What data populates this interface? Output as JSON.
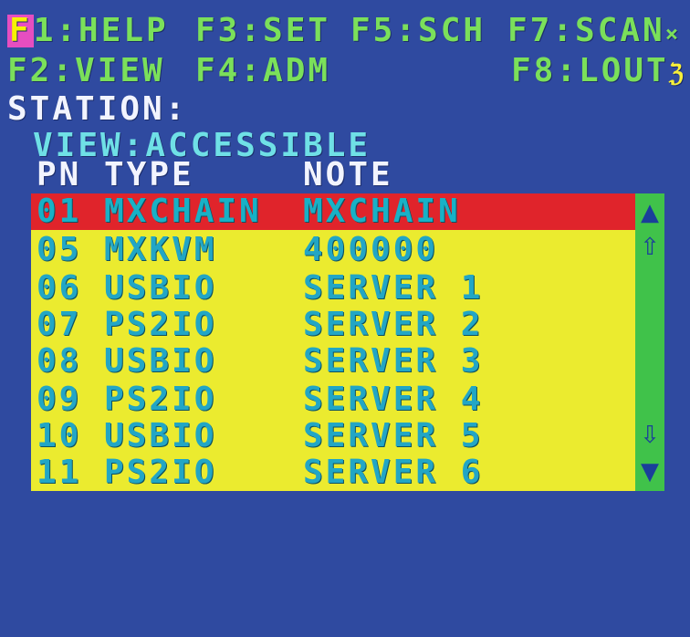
{
  "menu": {
    "f1_key": "F",
    "f1_rest": "1:HELP",
    "f3": "F3:SET",
    "f5": "F5:SCH",
    "f7": "F7:SCAN",
    "f7_icon": "×",
    "f2": "F2:VIEW",
    "f4": "F4:ADM",
    "f8": "F8:LOUT",
    "f8_icon": "ℨ"
  },
  "station_label": "STATION:",
  "view_label": "VIEW:ACCESSIBLE",
  "columns": {
    "pn": "PN",
    "type": "TYPE",
    "note": "NOTE"
  },
  "rows": [
    {
      "pn": "01",
      "type": "MXCHAIN",
      "note": "MXCHAIN"
    },
    {
      "pn": "05",
      "type": "MXKVM",
      "note": "400000"
    },
    {
      "pn": "06",
      "type": "USBIO",
      "note": "SERVER 1"
    },
    {
      "pn": "07",
      "type": "PS2IO",
      "note": "SERVER 2"
    },
    {
      "pn": "08",
      "type": "USBIO",
      "note": "SERVER 3"
    },
    {
      "pn": "09",
      "type": "PS2IO",
      "note": "SERVER 4"
    },
    {
      "pn": "10",
      "type": "USBIO",
      "note": "SERVER 5"
    },
    {
      "pn": "11",
      "type": "PS2IO",
      "note": "SERVER 6"
    }
  ],
  "selected_row": "01",
  "scrollbar": {
    "page_up_icon": "▲",
    "line_up_icon": "⇧",
    "line_down_icon": "⇩",
    "page_down_icon": "▼"
  },
  "colors": {
    "background": "#2f4aa0",
    "menu_text": "#7be05a",
    "header_text": "#f2f4ff",
    "view_text": "#6fe0e6",
    "list_background": "#ebeb2f",
    "list_text": "#22a6c5",
    "selected_row": "#e0242b",
    "scrollbar": "#40c24a",
    "f1_highlight": "#e64ec0"
  }
}
